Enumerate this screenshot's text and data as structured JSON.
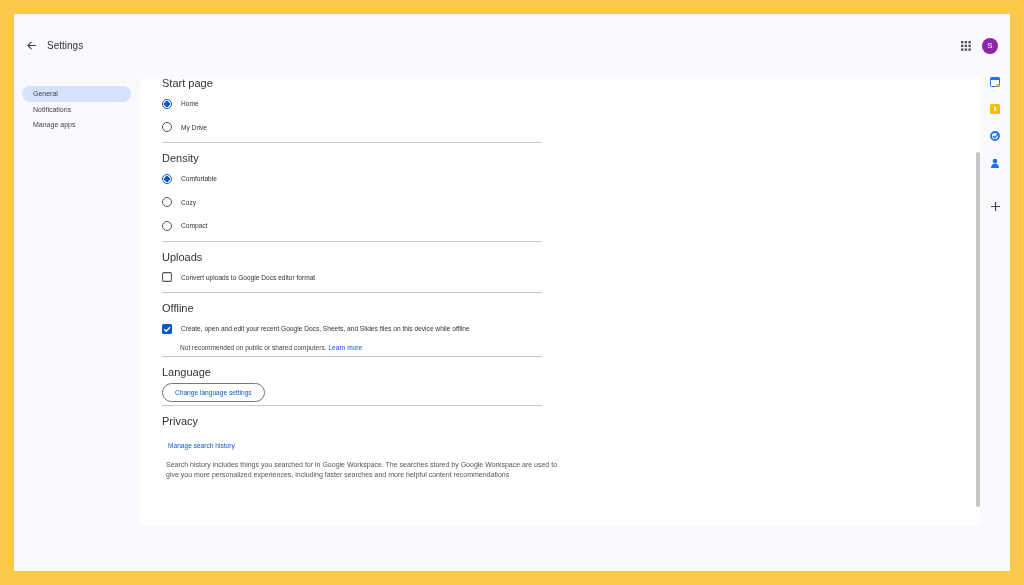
{
  "header": {
    "title": "Settings",
    "avatar": "S"
  },
  "sidebar": {
    "items": [
      {
        "label": "General",
        "selected": true
      },
      {
        "label": "Notifications",
        "selected": false
      },
      {
        "label": "Manage apps",
        "selected": false
      }
    ]
  },
  "sections": [
    {
      "title": "Start page",
      "items": [
        {
          "kind": "radio",
          "label": "Home",
          "selected": true
        },
        {
          "kind": "radio",
          "label": "My Drive",
          "selected": false
        }
      ]
    },
    {
      "title": "Density",
      "items": [
        {
          "kind": "radio",
          "label": "Comfortable",
          "selected": true
        },
        {
          "kind": "radio",
          "label": "Cozy",
          "selected": false
        },
        {
          "kind": "radio",
          "label": "Compact",
          "selected": false
        }
      ]
    },
    {
      "title": "Uploads",
      "items": [
        {
          "kind": "checkbox",
          "label": "Convert uploads to Google Docs editor format",
          "checked": false
        }
      ]
    },
    {
      "title": "Offline",
      "items": [
        {
          "kind": "checkbox",
          "label": "Create, open and edit your recent Google Docs, Sheets, and Slides files on this device while offline",
          "checked": true
        },
        {
          "kind": "note",
          "label": "Not recommended on public or shared computers.",
          "link": "Learn more"
        }
      ]
    },
    {
      "title": "Language",
      "items": [
        {
          "kind": "button",
          "label": "Change language settings"
        }
      ]
    },
    {
      "title": "Privacy",
      "items": [
        {
          "kind": "link",
          "label": "Manage search history"
        },
        {
          "kind": "text",
          "label": "Search history includes things you searched for in Google Workspace. The searches stored by Google Workspace are used to give you more personalized experiences, including faster searches and more helpful content recommendations"
        }
      ]
    }
  ]
}
